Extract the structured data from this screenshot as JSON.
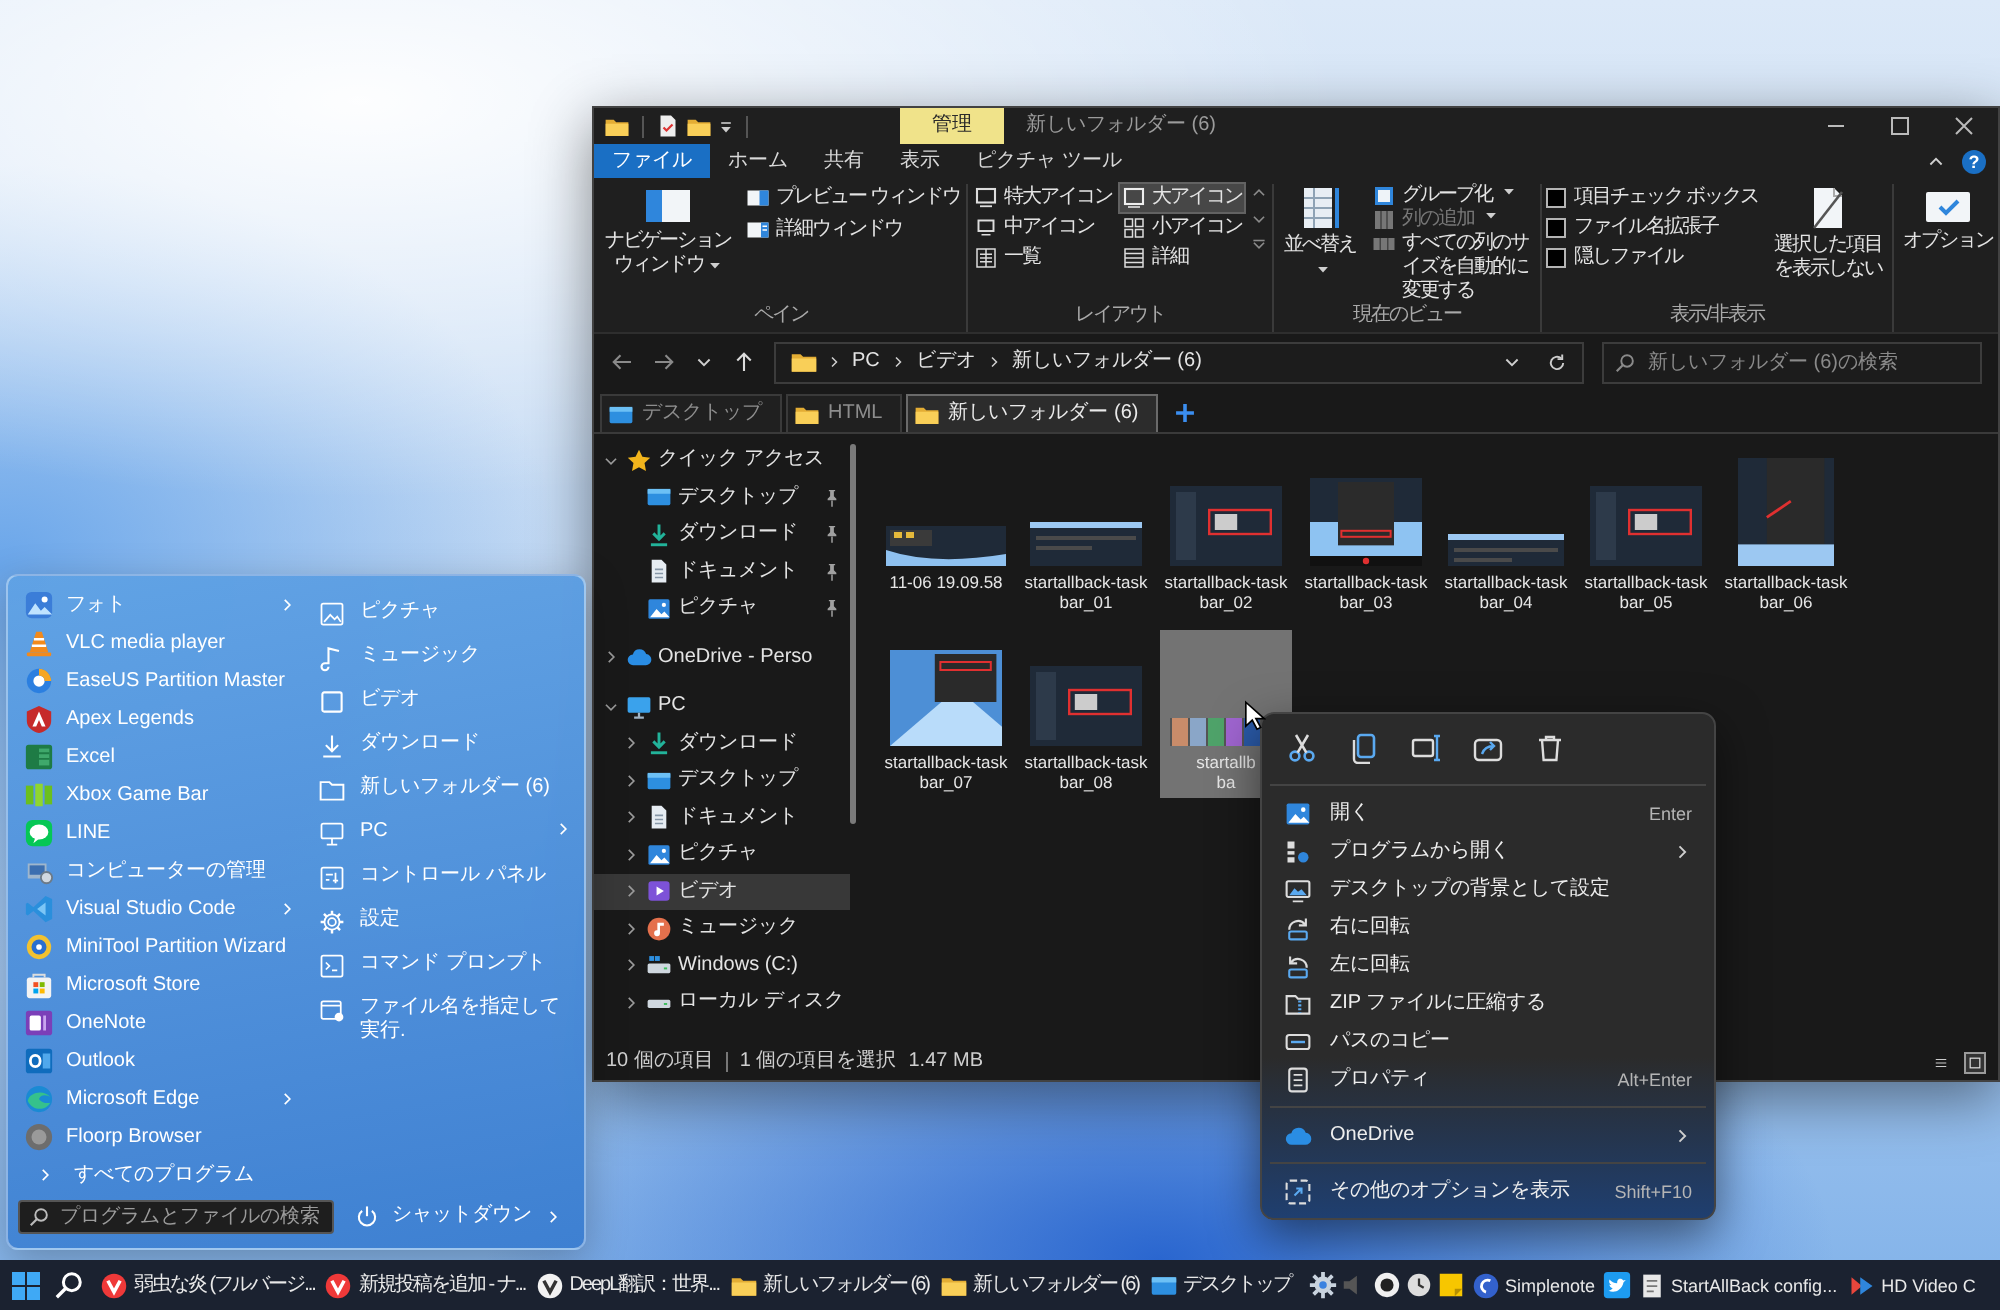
{
  "explorer": {
    "title_bar": {
      "context_tab": "管理",
      "title": "新しいフォルダー (6)"
    },
    "ribbon_tabs": [
      {
        "label": "ファイル",
        "kind": "file"
      },
      {
        "label": "ホーム",
        "kind": "tab"
      },
      {
        "label": "共有",
        "kind": "tab"
      },
      {
        "label": "表示",
        "kind": "tab"
      },
      {
        "label": "ピクチャ ツール",
        "kind": "tab"
      }
    ],
    "help_button": "?",
    "ribbon": {
      "pane": {
        "label": "ペイン",
        "navigation_pane": "ナビゲーションウィンドウ",
        "buttons": [
          "プレビュー ウィンドウ",
          "詳細ウィンドウ"
        ]
      },
      "layout": {
        "label": "レイアウト",
        "options": [
          {
            "label": "特大アイコン",
            "selected": false
          },
          {
            "label": "大アイコン",
            "selected": true
          },
          {
            "label": "中アイコン",
            "selected": false
          },
          {
            "label": "小アイコン",
            "selected": false
          },
          {
            "label": "一覧",
            "selected": false
          },
          {
            "label": "詳細",
            "selected": false
          }
        ]
      },
      "current_view": {
        "label": "現在のビュー",
        "sort_button": "並べ替え",
        "buttons": [
          {
            "label": "グループ化",
            "disabled": false,
            "dropdown": true
          },
          {
            "label": "列の追加",
            "disabled": true,
            "dropdown": true
          },
          {
            "label": "すべての列のサイズを自動的に変更する",
            "disabled": false,
            "dropdown": false
          }
        ]
      },
      "show_hide": {
        "label": "表示/非表示",
        "checkboxes": [
          {
            "label": "項目チェック ボックス",
            "checked": false
          },
          {
            "label": "ファイル名拡張子",
            "checked": false
          },
          {
            "label": "隠しファイル",
            "checked": false
          }
        ],
        "hide_selected_button": "選択した項目を表示しない"
      },
      "options_button": "オプション"
    },
    "address": {
      "path": [
        "PC",
        "ビデオ",
        "新しいフォルダー (6)"
      ]
    },
    "search": {
      "placeholder": "新しいフォルダー (6)の検索"
    },
    "folder_tabs": [
      {
        "label": "デスクトップ",
        "kind": "desktop",
        "selected": false
      },
      {
        "label": "HTML",
        "kind": "folder",
        "selected": false
      },
      {
        "label": "新しいフォルダー (6)",
        "kind": "folder",
        "selected": true
      }
    ],
    "tree": [
      {
        "label": "クイック アクセス",
        "kind": "favorites",
        "expanded": true,
        "selected": false,
        "children": [
          {
            "label": "デスクトップ",
            "kind": "desktop",
            "pinned": true,
            "selected": false
          },
          {
            "label": "ダウンロード",
            "kind": "downloads",
            "pinned": true,
            "selected": false
          },
          {
            "label": "ドキュメント",
            "kind": "documents",
            "pinned": true,
            "selected": false
          },
          {
            "label": "ピクチャ",
            "kind": "pictures",
            "pinned": true,
            "selected": false
          }
        ]
      },
      {
        "label": "OneDrive - Perso",
        "kind": "cloud",
        "expanded": false,
        "selected": false
      },
      {
        "label": "PC",
        "kind": "computer",
        "expanded": true,
        "selected": false,
        "children": [
          {
            "label": "ダウンロード",
            "kind": "downloads",
            "expanded": false,
            "selected": false
          },
          {
            "label": "デスクトップ",
            "kind": "desktop",
            "expanded": false,
            "selected": false
          },
          {
            "label": "ドキュメント",
            "kind": "documents",
            "expanded": false,
            "selected": false
          },
          {
            "label": "ピクチャ",
            "kind": "pictures",
            "expanded": false,
            "selected": false
          },
          {
            "label": "ビデオ",
            "kind": "videos",
            "expanded": false,
            "selected": true
          },
          {
            "label": "ミュージック",
            "kind": "music",
            "expanded": false,
            "selected": false
          },
          {
            "label": "Windows (C:)",
            "kind": "system-drive",
            "expanded": false,
            "selected": false
          },
          {
            "label": "ローカル ディスク",
            "kind": "drive",
            "expanded": false,
            "selected": false
          }
        ]
      }
    ],
    "files": [
      {
        "name": "11-06 19.09.58",
        "selected": false
      },
      {
        "name": "startallback-task\nbar_01",
        "selected": false
      },
      {
        "name": "startallback-task\nbar_02",
        "selected": false
      },
      {
        "name": "startallback-task\nbar_03",
        "selected": false
      },
      {
        "name": "startallback-task\nbar_04",
        "selected": false
      },
      {
        "name": "startallback-task\nbar_05",
        "selected": false
      },
      {
        "name": "startallback-task\nbar_06",
        "selected": false
      },
      {
        "name": "startallback-task\nbar_07",
        "selected": false
      },
      {
        "name": "startallback-task\nbar_08",
        "selected": false
      },
      {
        "name": "startallb\nba",
        "selected": true
      }
    ],
    "status_bar": {
      "item_count": "10 個の項目",
      "selection": "1 個の項目を選択",
      "size": "1.47 MB",
      "views": [
        {
          "kind": "details",
          "selected": false
        },
        {
          "kind": "thumbnails",
          "selected": true
        }
      ]
    }
  },
  "context_menu": {
    "sections": [
      {
        "items": [
          {
            "label": "開く",
            "shortcut": "Enter",
            "submenu": false
          },
          {
            "label": "プログラムから開く",
            "submenu": true
          },
          {
            "label": "デスクトップの背景として設定",
            "submenu": false
          },
          {
            "label": "右に回転",
            "submenu": false
          },
          {
            "label": "左に回転",
            "submenu": false
          },
          {
            "label": "ZIP ファイルに圧縮する",
            "submenu": false
          },
          {
            "label": "パスのコピー",
            "submenu": false
          },
          {
            "label": "プロパティ",
            "shortcut": "Alt+Enter",
            "submenu": false
          }
        ]
      },
      {
        "items": [
          {
            "label": "OneDrive",
            "submenu": true
          }
        ]
      },
      {
        "items": [
          {
            "label": "その他のオプションを表示",
            "shortcut": "Shift+F10",
            "submenu": false
          }
        ]
      }
    ]
  },
  "start_menu": {
    "apps": [
      {
        "label": "フォト",
        "submenu": true
      },
      {
        "label": "VLC media player",
        "submenu": false
      },
      {
        "label": "EaseUS Partition Master",
        "submenu": false
      },
      {
        "label": "Apex Legends",
        "submenu": false
      },
      {
        "label": "Excel",
        "submenu": false
      },
      {
        "label": "Xbox Game Bar",
        "submenu": false
      },
      {
        "label": "LINE",
        "submenu": false
      },
      {
        "label": "コンピューターの管理",
        "submenu": false
      },
      {
        "label": "Visual Studio Code",
        "submenu": true
      },
      {
        "label": "MiniTool Partition Wizard",
        "submenu": false
      },
      {
        "label": "Microsoft Store",
        "submenu": false
      },
      {
        "label": "OneNote",
        "submenu": false
      },
      {
        "label": "Outlook",
        "submenu": false
      },
      {
        "label": "Microsoft Edge",
        "submenu": true
      },
      {
        "label": "Floorp Browser",
        "submenu": false
      }
    ],
    "all_programs": "すべてのプログラム",
    "search": {
      "placeholder": "プログラムとファイルの検索"
    },
    "places": [
      {
        "label": "ピクチャ",
        "submenu": false
      },
      {
        "label": "ミュージック",
        "submenu": false
      },
      {
        "label": "ビデオ",
        "submenu": false
      },
      {
        "label": "ダウンロード",
        "submenu": false
      },
      {
        "label": "新しいフォルダー (6)",
        "submenu": false
      },
      {
        "label": "PC",
        "submenu": true
      },
      {
        "label": "コントロール パネル",
        "submenu": false
      },
      {
        "label": "設定",
        "submenu": false
      },
      {
        "label": "コマンド プロンプト",
        "submenu": false
      },
      {
        "label": "ファイル名を指定して実行.",
        "submenu": false
      }
    ],
    "shutdown": "シャットダウン"
  },
  "taskbar": {
    "windows": [
      "弱虫な炎 (フルバージ...",
      "新規投稿を追加 - ナ...",
      "DeepL翻訳：世界...",
      "新しいフォルダー (6)",
      "新しいフォルダー (6)",
      "デスクトップ"
    ],
    "apps": [
      "Simplenote",
      "StartAllBack config...",
      "HD Video C"
    ]
  }
}
